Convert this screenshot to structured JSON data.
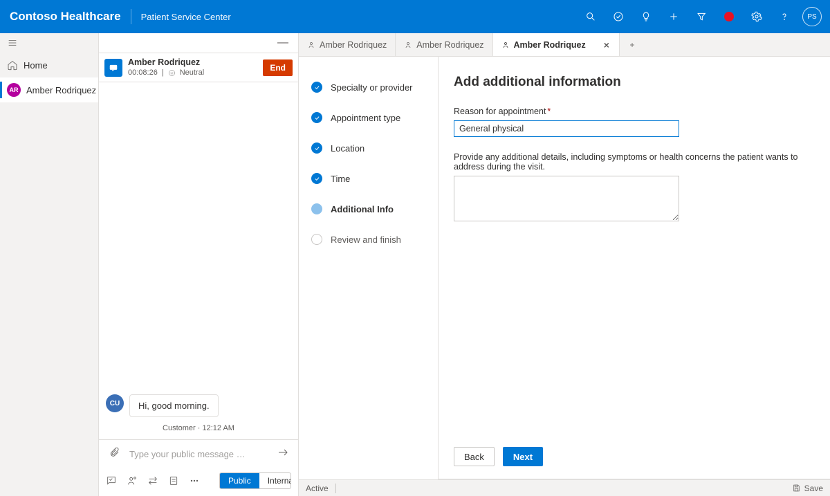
{
  "header": {
    "brand": "Contoso Healthcare",
    "subtitle": "Patient Service Center",
    "avatar_initials": "PS"
  },
  "rail": {
    "home_label": "Home",
    "session": {
      "initials": "AR",
      "name": "Amber Rodriquez"
    }
  },
  "conversation": {
    "session": {
      "name": "Amber Rodriquez",
      "timer": "00:08:26",
      "sentiment": "Neutral",
      "end_label": "End"
    },
    "message": {
      "sender_initials": "CU",
      "text": "Hi, good morning.",
      "meta": "Customer · 12:12 AM"
    },
    "composer": {
      "placeholder": "Type your public message …",
      "toggle": {
        "public": "Public",
        "internal": "Internal"
      }
    }
  },
  "tabs": {
    "items": [
      {
        "label": "Amber Rodriquez",
        "active": false
      },
      {
        "label": "Amber Rodriquez",
        "active": false
      },
      {
        "label": "Amber Rodriquez",
        "active": true
      }
    ]
  },
  "wizard": {
    "steps": {
      "specialty": "Specialty or provider",
      "appointment": "Appointment type",
      "location": "Location",
      "time": "Time",
      "additional": "Additional Info",
      "review": "Review and finish"
    },
    "form": {
      "heading": "Add additional information",
      "reason_label": "Reason for appointment",
      "reason_value": "General physical",
      "details_label": "Provide any additional details, including symptoms or health concerns the patient wants to address during the visit.",
      "details_value": "",
      "back": "Back",
      "next": "Next"
    }
  },
  "statusbar": {
    "active": "Active",
    "save": "Save"
  }
}
